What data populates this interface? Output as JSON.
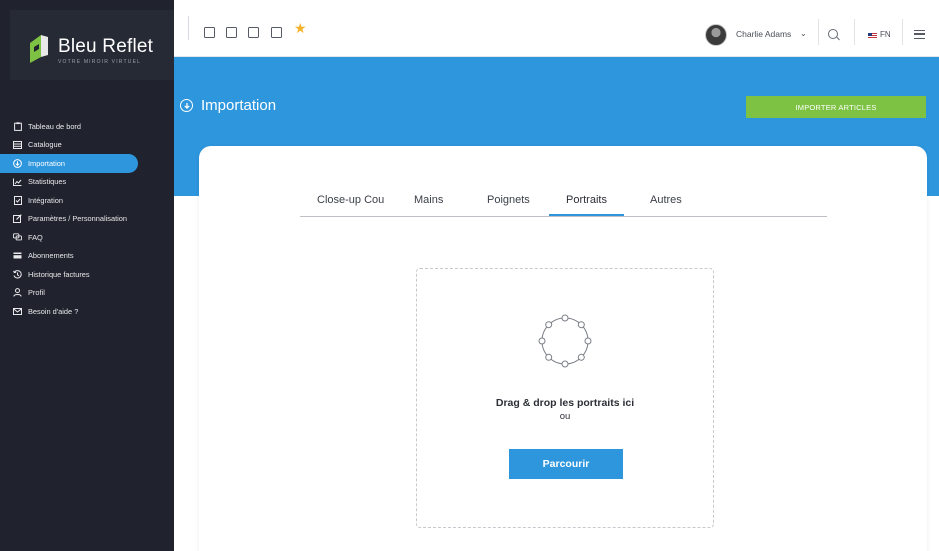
{
  "brand": {
    "name": "Bleu Reflet",
    "tagline": "VOTRE MIROIR VIRTUEL"
  },
  "sidebar": {
    "items": [
      {
        "label": "Tableau de bord",
        "icon": "clipboard-icon",
        "active": false
      },
      {
        "label": "Catalogue",
        "icon": "catalog-icon",
        "active": false
      },
      {
        "label": "Importation",
        "icon": "import-icon",
        "active": true
      },
      {
        "label": "Statistiques",
        "icon": "chart-icon",
        "active": false
      },
      {
        "label": "Intégration",
        "icon": "integration-icon",
        "active": false
      },
      {
        "label": "Paramètres / Personnalisation",
        "icon": "edit-icon",
        "active": false
      },
      {
        "label": "FAQ",
        "icon": "chat-icon",
        "active": false
      },
      {
        "label": "Abonnements",
        "icon": "card-icon",
        "active": false
      },
      {
        "label": "Historique factures",
        "icon": "history-icon",
        "active": false
      },
      {
        "label": "Profil",
        "icon": "user-icon",
        "active": false
      },
      {
        "label": "Besoin d'aide ?",
        "icon": "mail-icon",
        "active": false
      }
    ]
  },
  "topbar": {
    "icons": [
      "calendar-icon",
      "mail-icon",
      "contact-icon",
      "checkbox-icon",
      "star-icon"
    ],
    "user_name": "Charlie Adams",
    "caret": "⌄",
    "language": "FN"
  },
  "main": {
    "title": "Importation",
    "import_button": "IMPORTER ARTICLES",
    "tabs": [
      {
        "label": "Close-up Cou",
        "active": false
      },
      {
        "label": "Mains",
        "active": false
      },
      {
        "label": "Poignets",
        "active": false
      },
      {
        "label": "Portraits",
        "active": true
      },
      {
        "label": "Autres",
        "active": false
      }
    ],
    "dropzone": {
      "title": "Drag & drop les portraits ici",
      "or": "ou",
      "browse": "Parcourir"
    }
  },
  "colors": {
    "accent": "#2e96dd",
    "sidebar_bg": "#20232d",
    "import_button": "#7dc242",
    "star": "#f4b22a"
  }
}
